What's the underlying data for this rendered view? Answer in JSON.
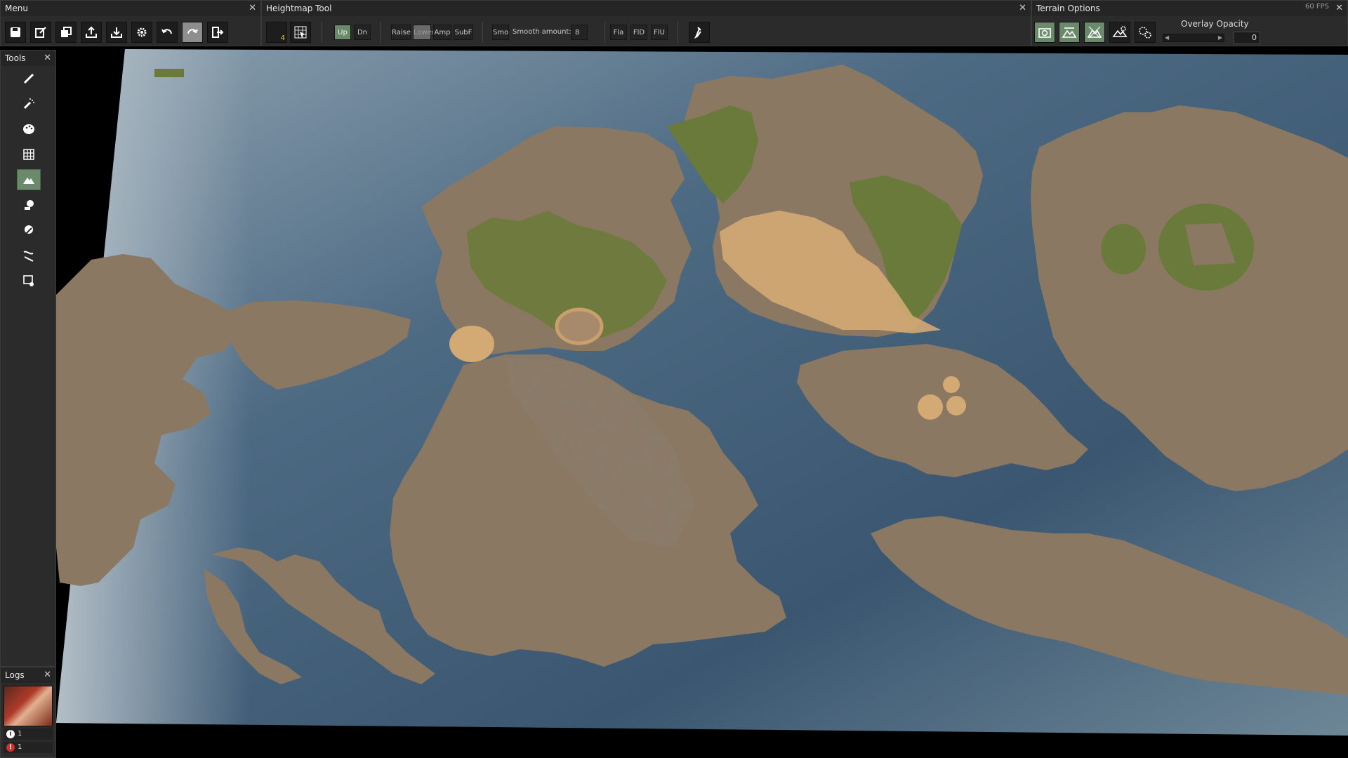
{
  "fps": "60 FPS",
  "menu": {
    "title": "Menu",
    "close": "✕",
    "buttons": [
      {
        "name": "save-icon"
      },
      {
        "name": "edit-icon"
      },
      {
        "name": "copy-icon"
      },
      {
        "name": "export-icon"
      },
      {
        "name": "import-icon"
      },
      {
        "name": "settings-icon"
      },
      {
        "name": "undo-icon"
      },
      {
        "name": "redo-icon"
      },
      {
        "name": "exit-icon"
      }
    ]
  },
  "heightmap": {
    "title": "Heightmap Tool",
    "close": "✕",
    "brush_size": "4",
    "up": "Up",
    "dn": "Dn",
    "raise": "Raise",
    "lower": "Lower",
    "amp": "Amp",
    "subf": "SubF",
    "smo": "Smo",
    "smooth_label": "Smooth amount:",
    "smooth_value": "8",
    "fla": "Fla",
    "fld": "FlD",
    "flu": "FlU"
  },
  "terrain_options": {
    "title": "Terrain Options",
    "close": "✕",
    "overlay_label": "Overlay Opacity",
    "overlay_value": "0",
    "overlay_fraction": 0
  },
  "tools": {
    "title": "Tools",
    "close": "✕",
    "items": [
      {
        "name": "brush-icon"
      },
      {
        "name": "spray-brush-icon"
      },
      {
        "name": "palette-icon"
      },
      {
        "name": "grid-icon"
      },
      {
        "name": "heightmap-icon"
      },
      {
        "name": "paint-bucket-icon"
      },
      {
        "name": "paint-globe-icon"
      },
      {
        "name": "river-icon"
      },
      {
        "name": "map-edit-icon"
      }
    ]
  },
  "logs": {
    "title": "Logs",
    "close": "✕",
    "info_count": "1",
    "error_count": "1"
  },
  "colors": {
    "land": "#8b7863",
    "water_deep": "#35506b",
    "water_shallow": "#6e8aa0",
    "grass": "#6a7a3a",
    "sand": "#d4aa74",
    "accent": "#6b8a6b"
  }
}
